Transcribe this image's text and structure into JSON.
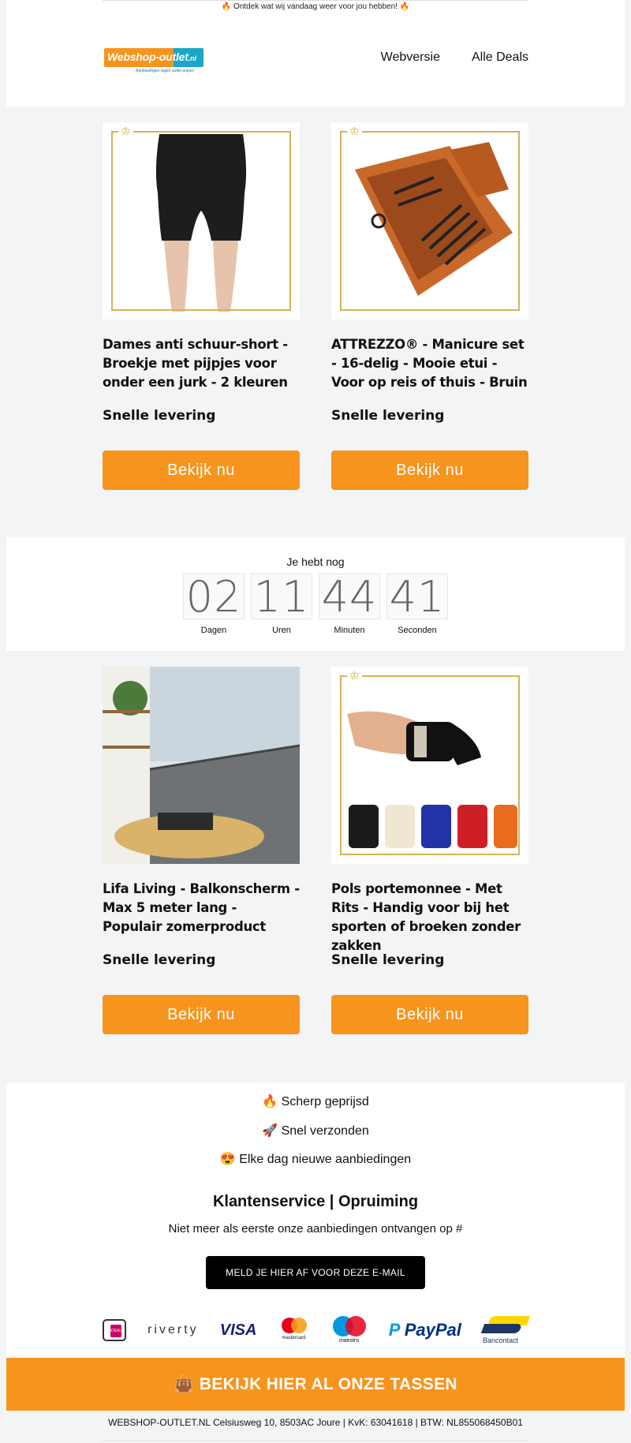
{
  "preheader": "🔥 Ontdek wat wij vandaag weer voor jou hebben! 🔥",
  "logo": {
    "text": "Webshop-outlet",
    "tld": ".nl",
    "tagline": "Aanbiedingen tegen outlet prijzen"
  },
  "nav": {
    "webversie": "Webversie",
    "alle_deals": "Alle Deals"
  },
  "products": [
    {
      "title": "Dames anti schuur-short - Broekje met pijpjes voor onder een jurk - 2 kleuren",
      "delivery": "Snelle levering",
      "button": "Bekijk nu",
      "image": "black-shorts-photo"
    },
    {
      "title": "ATTREZZO® - Manicure set - 16-delig - Mooie etui - Voor op reis of thuis - Bruin",
      "delivery": "Snelle levering",
      "button": "Bekijk nu",
      "image": "manicure-set-photo"
    },
    {
      "title": "Lifa Living - Balkonscherm - Max 5 meter lang - Populair zomerproduct",
      "delivery": "Snelle levering",
      "button": "Bekijk nu",
      "image": "balcony-screen-photo"
    },
    {
      "title": "Pols portemonnee - Met Rits - Handig voor bij het sporten of broeken zonder zakken",
      "delivery": "Snelle levering",
      "button": "Bekijk nu",
      "image": "wrist-wallet-photo"
    }
  ],
  "countdown": {
    "heading": "Je hebt nog",
    "days": "02",
    "hours": "11",
    "minutes": "44",
    "seconds": "41",
    "days_label": "Dagen",
    "hours_label": "Uren",
    "minutes_label": "Minuten",
    "seconds_label": "Seconden"
  },
  "usps": [
    "🔥 Scherp geprijsd",
    "🚀 Snel verzonden",
    "😍 Elke dag nieuwe aanbiedingen"
  ],
  "service": {
    "title": "Klantenservice | Opruiming",
    "unsubscribe_text": "Niet meer als eerste onze aanbiedingen ontvangen op #",
    "unsubscribe_button": "MELD JE HIER AF VOOR DEZE E-MAIL"
  },
  "payments": {
    "ideal": "iDEAL",
    "riverty": "riverty",
    "visa": "VISA",
    "mastercard": "mastercard",
    "maestro": "maestro",
    "paypal": "PayPal",
    "bancontact": "Bancontact"
  },
  "cta": "👜 BEKIJK HIER AL ONZE TASSEN",
  "footer": "WEBSHOP-OUTLET.NL Celsiusweg 10, 8503AC Joure | KvK: 63041618 | BTW: NL855068450B01",
  "colors": {
    "orange": "#f7941d",
    "gold": "#d6b25a",
    "logo_teal": "#1aa7c9"
  }
}
